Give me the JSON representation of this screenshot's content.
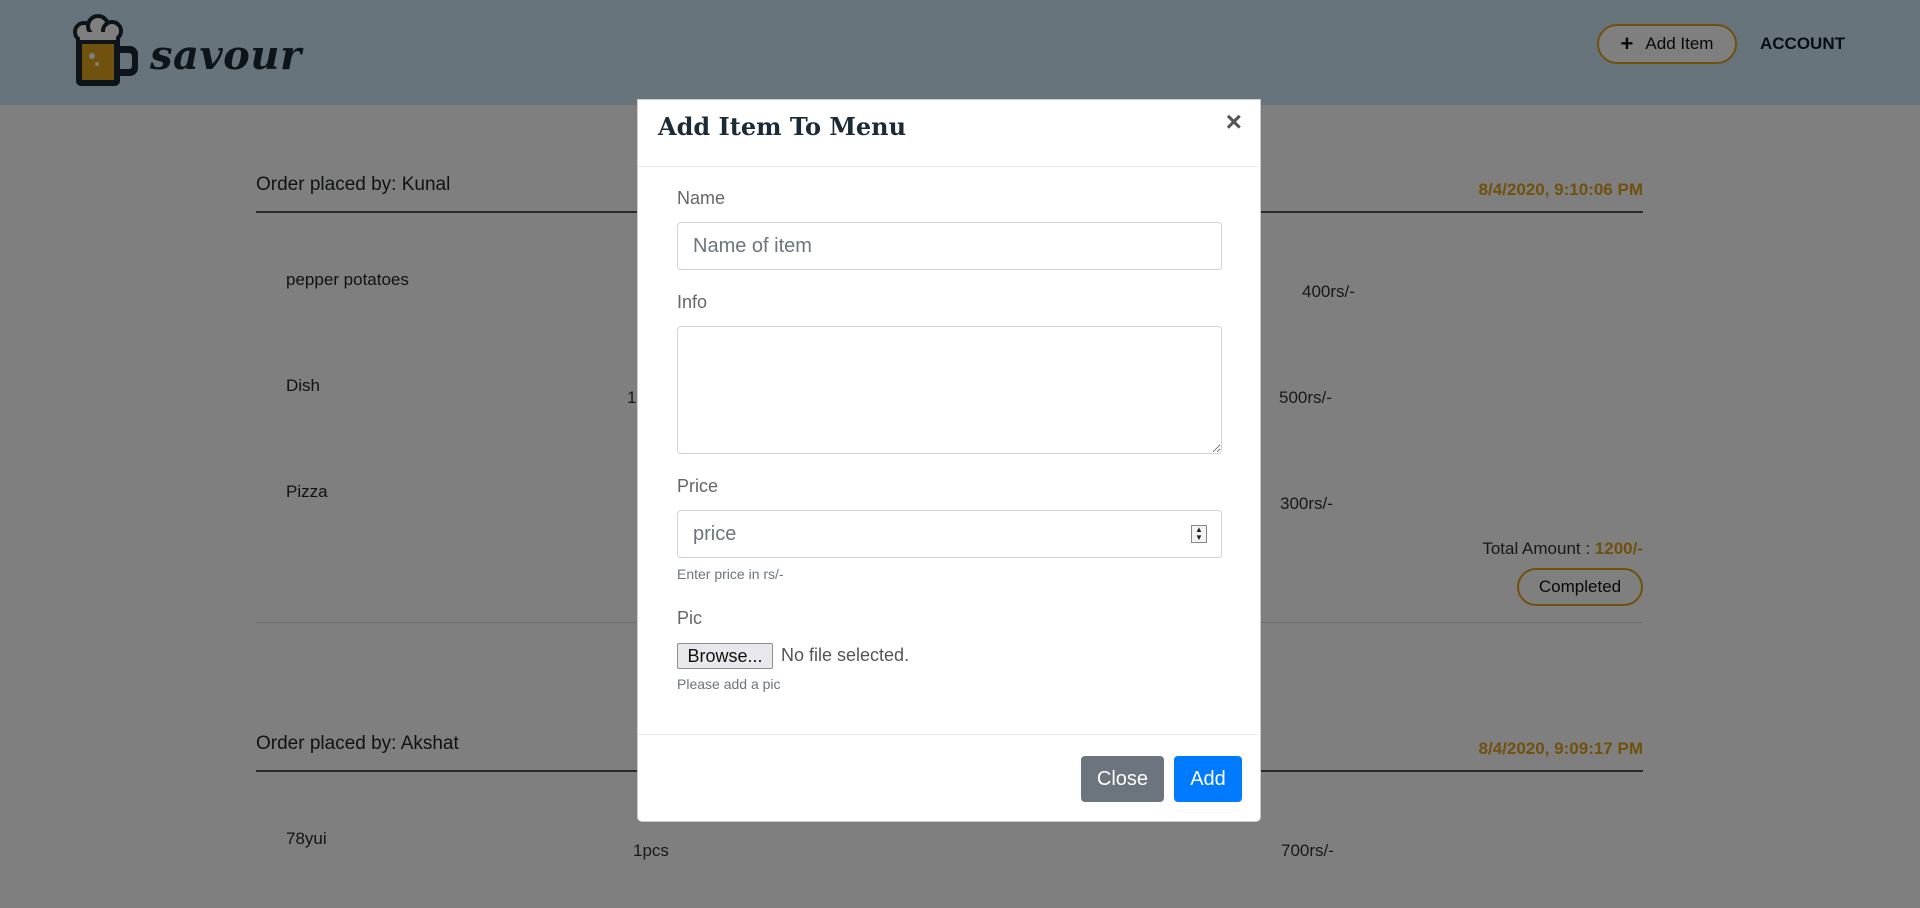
{
  "brand": {
    "name": "savour"
  },
  "nav": {
    "add_item_label": "Add Item",
    "account_label": "ACCOUNT"
  },
  "orders": [
    {
      "placed_by": "Order placed by: Kunal",
      "date": "8/4/2020, 9:10:06 PM",
      "items": [
        {
          "name": "pepper potatoes",
          "qty": "",
          "price": "400rs/-"
        },
        {
          "name": "Dish",
          "qty": "1",
          "price": "500rs/-"
        },
        {
          "name": "Pizza",
          "qty": "",
          "price": "300rs/-"
        }
      ],
      "total_label": "Total Amount : ",
      "total_value": "1200/-",
      "status": "Completed"
    },
    {
      "placed_by": "Order placed by: Akshat",
      "date": "8/4/2020, 9:09:17 PM",
      "items": [
        {
          "name": "78yui",
          "qty": "1pcs",
          "price": "700rs/-"
        }
      ]
    }
  ],
  "modal": {
    "title": "Add Item To Menu",
    "close_symbol": "×",
    "name": {
      "label": "Name",
      "placeholder": "Name of item"
    },
    "info": {
      "label": "Info",
      "placeholder": ""
    },
    "price": {
      "label": "Price",
      "placeholder": "price",
      "help": "Enter price in rs/-"
    },
    "pic": {
      "label": "Pic",
      "browse_label": "Browse...",
      "file_status": "No file selected.",
      "help": "Please add a pic"
    },
    "close_button": "Close",
    "add_button": "Add"
  },
  "colors": {
    "accent": "#e0a21b",
    "navbar": "#d1e8f7",
    "primary": "#007bff",
    "secondary": "#6c757d"
  }
}
